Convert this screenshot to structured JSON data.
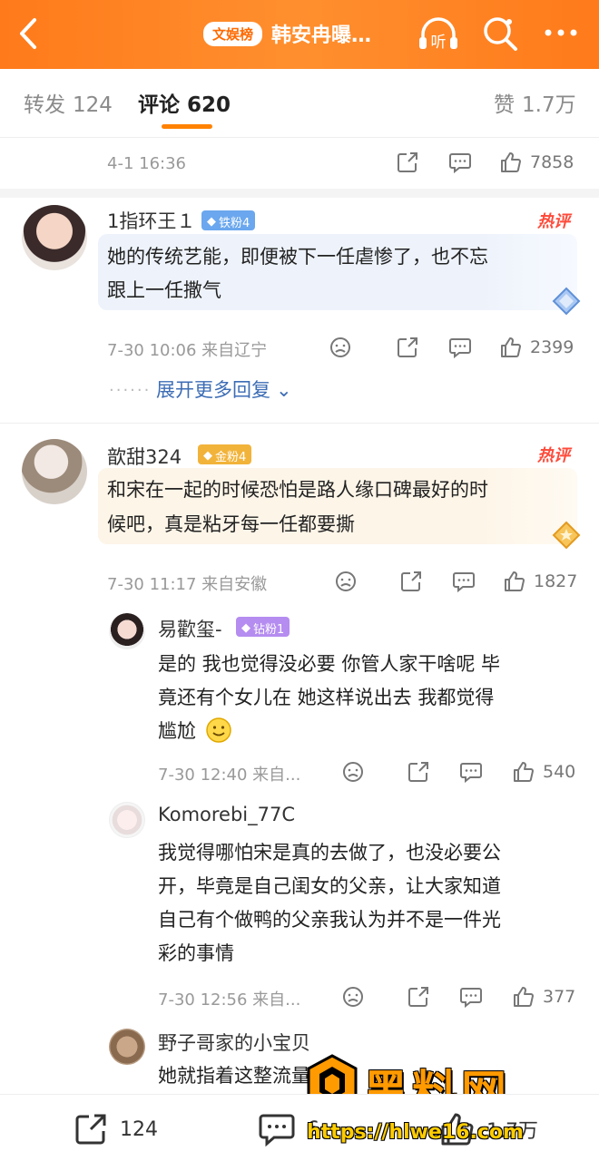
{
  "colors": {
    "accent": "#ff8200",
    "topbar": "#ff7a1a",
    "link": "#3d6db5",
    "hot": "#ff4a3a"
  },
  "header": {
    "badge": "文娱榜",
    "title": "韩安冉曝…",
    "icons": [
      "back-arrow-icon",
      "headphones-listen-icon",
      "search-icon",
      "more-icon"
    ],
    "listen_label": "听"
  },
  "tabs": [
    {
      "label": "转发",
      "count": "124"
    },
    {
      "label": "评论",
      "count": "620"
    },
    {
      "label": "赞",
      "count": "1.7万"
    }
  ],
  "post": {
    "time": "4-1 16:36",
    "likes": "7858"
  },
  "comments": [
    {
      "user": "1指环王１",
      "badge": "铁粉4",
      "hot_label": "热评",
      "text_line1": "她的传统艺能，即便被下一任虐惨了，也不忘",
      "text_line2": "跟上一任撒气",
      "meta": "7-30 10:06  来自辽宁",
      "likes": "2399",
      "expand": "展开更多回复"
    },
    {
      "user": "歆甜324",
      "badge": "金粉4",
      "hot_label": "热评",
      "text_line1": "和宋在一起的时候恐怕是路人缘口碑最好的时",
      "text_line2": "候吧，真是粘牙每一任都要撕",
      "meta": "7-30 11:17  来自安徽",
      "likes": "1827"
    }
  ],
  "replies": [
    {
      "user": "易歡玺-",
      "badge": "钻粉1",
      "text_line1": "是的 我也觉得没必要 你管人家干啥呢 毕",
      "text_line2": "竟还有个女儿在 她这样说出去 我都觉得",
      "text_line3": "尴尬",
      "meta": "7-30 12:40  来自...",
      "likes": "540"
    },
    {
      "user": "Komorebi_77C",
      "text_line1": "我觉得哪怕宋是真的去做了，也没必要公",
      "text_line2": "开，毕竟是自己闺女的父亲，让大家知道",
      "text_line3": "自己有个做鸭的父亲我认为并不是一件光",
      "text_line4": "彩的事情",
      "meta": "7-30 12:56  来自...",
      "likes": "377"
    },
    {
      "user": "野子哥家的小宝贝",
      "text_line1": "她就指着这整流量呢"
    }
  ],
  "bottom": {
    "repost": "124",
    "comment": "6",
    "like": "1.7万"
  },
  "watermark": {
    "text": "黑料网",
    "url": "https://hlwe16.com"
  }
}
